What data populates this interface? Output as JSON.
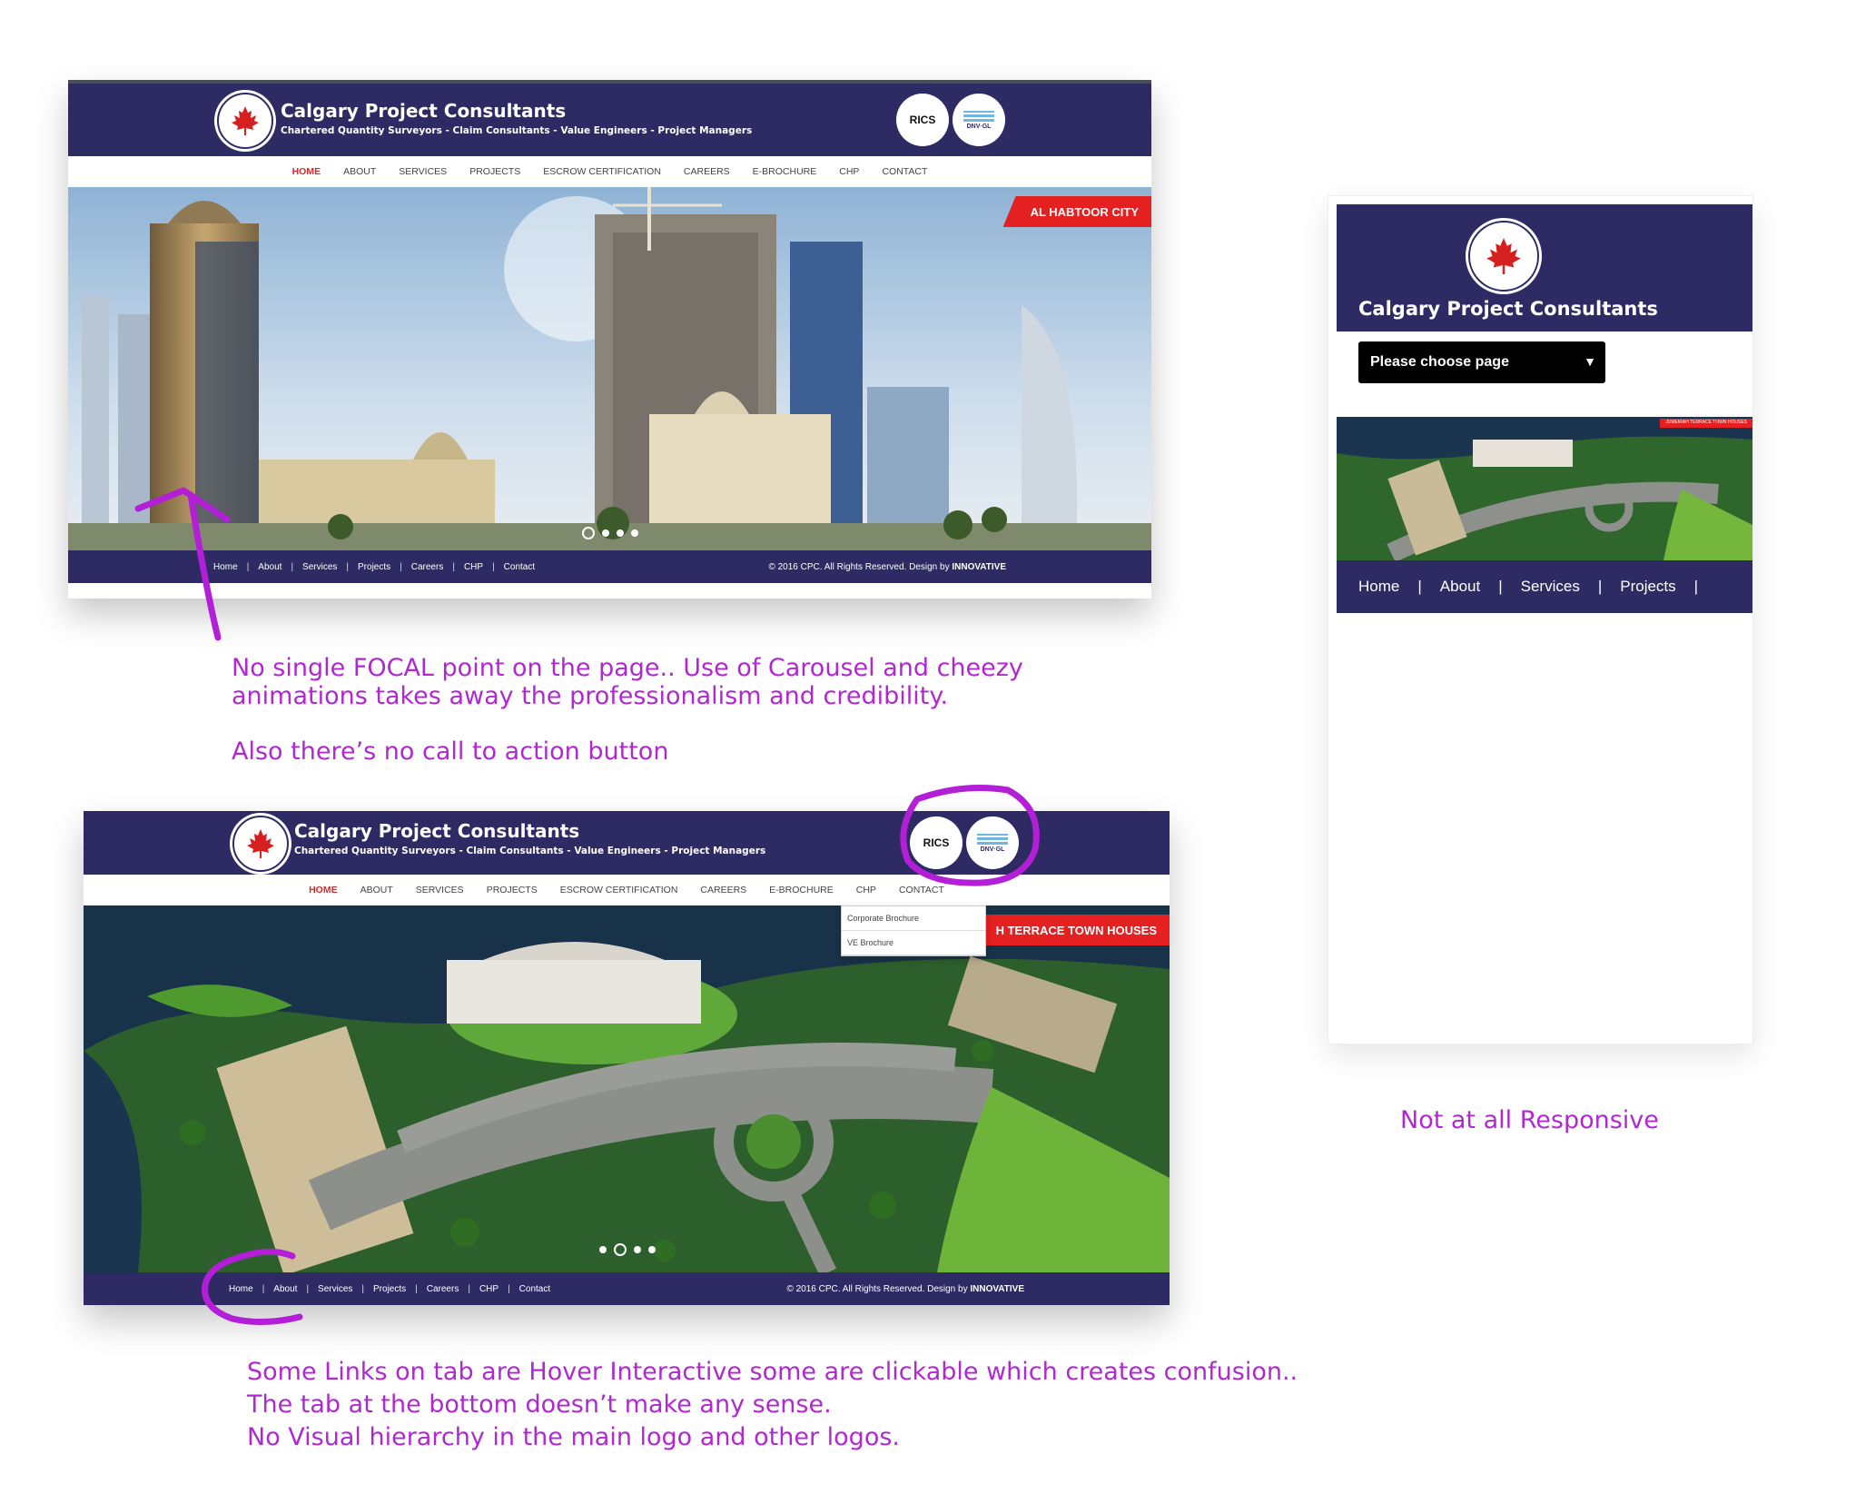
{
  "site": {
    "brand": "Calgary Project Consultants",
    "tagline": "Chartered Quantity Surveyors - Claim Consultants - Value Engineers - Project Managers",
    "badges": [
      "RICS",
      "DNV·GL"
    ],
    "nav": [
      "HOME",
      "ABOUT",
      "SERVICES",
      "PROJECTS",
      "ESCROW CERTIFICATION",
      "CAREERS",
      "E-BROCHURE",
      "CHP",
      "CONTACT"
    ],
    "footer_links": [
      "Home",
      "About",
      "Services",
      "Projects",
      "Careers",
      "CHP",
      "Contact"
    ],
    "footer_sep": "|",
    "copyright": "© 2016 CPC. All Rights Reserved. Design by",
    "designer": "INNOVATIVE",
    "colors": {
      "header": "#2e2b64",
      "accent": "#e42020",
      "nav_active": "#d42a2a",
      "annotation": "#b028d0"
    }
  },
  "shot1": {
    "ribbon": "AL HABTOOR CITY"
  },
  "shot2": {
    "ribbon": "H TERRACE TOWN HOUSES",
    "dropdown": [
      "Corporate Brochure",
      "VE Brochure"
    ]
  },
  "mobile": {
    "select_placeholder": "Please choose page",
    "footer_links": [
      "Home",
      "About",
      "Services",
      "Projects"
    ],
    "ribbon": "JUMEIRAH TERRACE TOWN HOUSES"
  },
  "notes": {
    "focal_1": "No single FOCAL point on the page.. Use of Carousel and cheezy",
    "focal_2": "animations takes away the professionalism and credibility.",
    "cta": "Also there’s no call to action button",
    "responsive": "Not at all Responsive",
    "hover_1": "Some Links on tab are Hover Interactive some are clickable which creates confusion..",
    "hover_2": "The tab at the bottom doesn’t make any sense.",
    "hover_3": "No Visual hierarchy in the main logo and other logos."
  }
}
